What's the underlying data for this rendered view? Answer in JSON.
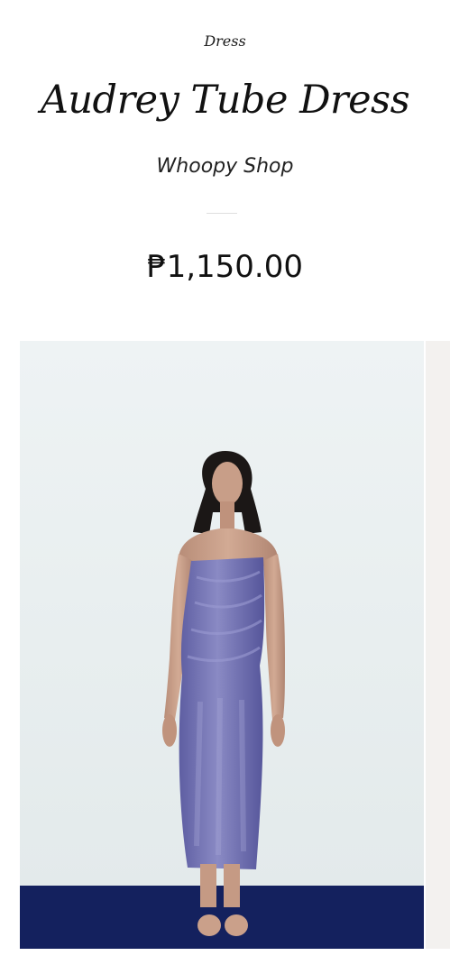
{
  "product": {
    "category": "Dress",
    "title": "Audrey Tube Dress",
    "shop": "Whoopy Shop",
    "price": "₱1,150.00"
  },
  "image": {
    "description_icon": "product-photo",
    "colors": {
      "wall": "#e9eeee",
      "floor": "#14215e",
      "dress": "#6f6fb0",
      "skin": "#c9a08a",
      "hair": "#1b1716"
    }
  }
}
